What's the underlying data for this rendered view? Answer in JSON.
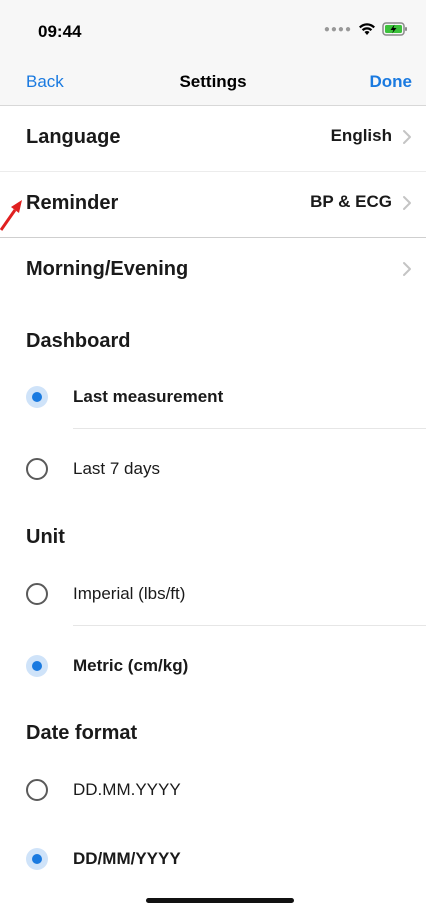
{
  "status_bar": {
    "time": "09:44",
    "icons": [
      "signal-icon",
      "wifi-icon",
      "battery-charging-icon"
    ]
  },
  "nav": {
    "back_label": "Back",
    "title": "Settings",
    "done_label": "Done"
  },
  "settings_rows": [
    {
      "label": "Language",
      "value": "English"
    },
    {
      "label": "Reminder",
      "value": "BP & ECG"
    },
    {
      "label": "Morning/Evening",
      "value": ""
    }
  ],
  "dashboard": {
    "header": "Dashboard",
    "options": [
      {
        "label": "Last measurement",
        "selected": true
      },
      {
        "label": "Last 7 days",
        "selected": false
      }
    ]
  },
  "unit": {
    "header": "Unit",
    "options": [
      {
        "label": "Imperial (lbs/ft)",
        "selected": false
      },
      {
        "label": "Metric (cm/kg)",
        "selected": true
      }
    ]
  },
  "date_format": {
    "header": "Date format",
    "options": [
      {
        "label": "DD.MM.YYYY",
        "selected": false
      },
      {
        "label": "DD/MM/YYYY",
        "selected": true
      }
    ]
  },
  "colors": {
    "accent": "#1a7ae0",
    "annotation": "#e02020"
  }
}
